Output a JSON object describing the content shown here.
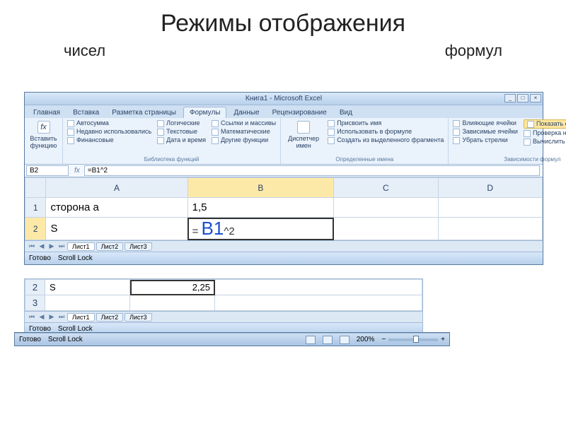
{
  "slide": {
    "title": "Режимы отображения",
    "sub_left": "чисел",
    "sub_right": "формул"
  },
  "window": {
    "title": "Книга1 - Microsoft Excel",
    "tabs": [
      "Главная",
      "Вставка",
      "Разметка страницы",
      "Формулы",
      "Данные",
      "Рецензирование",
      "Вид"
    ],
    "active_tab": 3
  },
  "ribbon": {
    "insert_fn": {
      "label": "Вставить функцию",
      "icon": "fx"
    },
    "lib": {
      "title": "Библиотека функций",
      "col1": [
        "Автосумма",
        "Недавно использовались",
        "Финансовые"
      ],
      "col2": [
        "Логические",
        "Текстовые",
        "Дата и время"
      ],
      "col3": [
        "Ссылки и массивы",
        "Математические",
        "Другие функции"
      ]
    },
    "names": {
      "big": "Диспетчер имен",
      "items": [
        "Присвоить имя",
        "Использовать в формуле",
        "Создать из выделенного фрагмента"
      ],
      "title": "Определенные имена"
    },
    "audit": {
      "col1": [
        "Влияющие ячейки",
        "Зависимые ячейки",
        "Убрать стрелки"
      ],
      "col2_highlight": "Показать формулы",
      "col2": [
        "Проверка наличия ошибок",
        "Вычислить формулу"
      ],
      "title": "Зависимости формул"
    }
  },
  "formula_bar": {
    "namebox": "B2",
    "fx": "=B1^2"
  },
  "grid_main": {
    "columns": [
      "A",
      "B",
      "C",
      "D"
    ],
    "rows": [
      {
        "n": "1",
        "A": "сторона а",
        "B": "1,5",
        "C": "",
        "D": ""
      },
      {
        "n": "2",
        "A": "S",
        "B_formula": {
          "pre": "= ",
          "ref": "B1",
          "post": "^2"
        },
        "C": "",
        "D": ""
      }
    ]
  },
  "sheet_tabs": [
    "Лист1",
    "Лист2",
    "Лист3"
  ],
  "statusbar": {
    "ready": "Готово",
    "scroll": "Scroll Lock",
    "zoom": "200%"
  },
  "frag2": {
    "rows": [
      {
        "n": "2",
        "A": "S",
        "B": "2,25"
      },
      {
        "n": "3",
        "A": "",
        "B": ""
      }
    ]
  },
  "frag3_status": {
    "ready": "Готово",
    "scroll": "Scroll Lock",
    "zoom": "200%"
  }
}
